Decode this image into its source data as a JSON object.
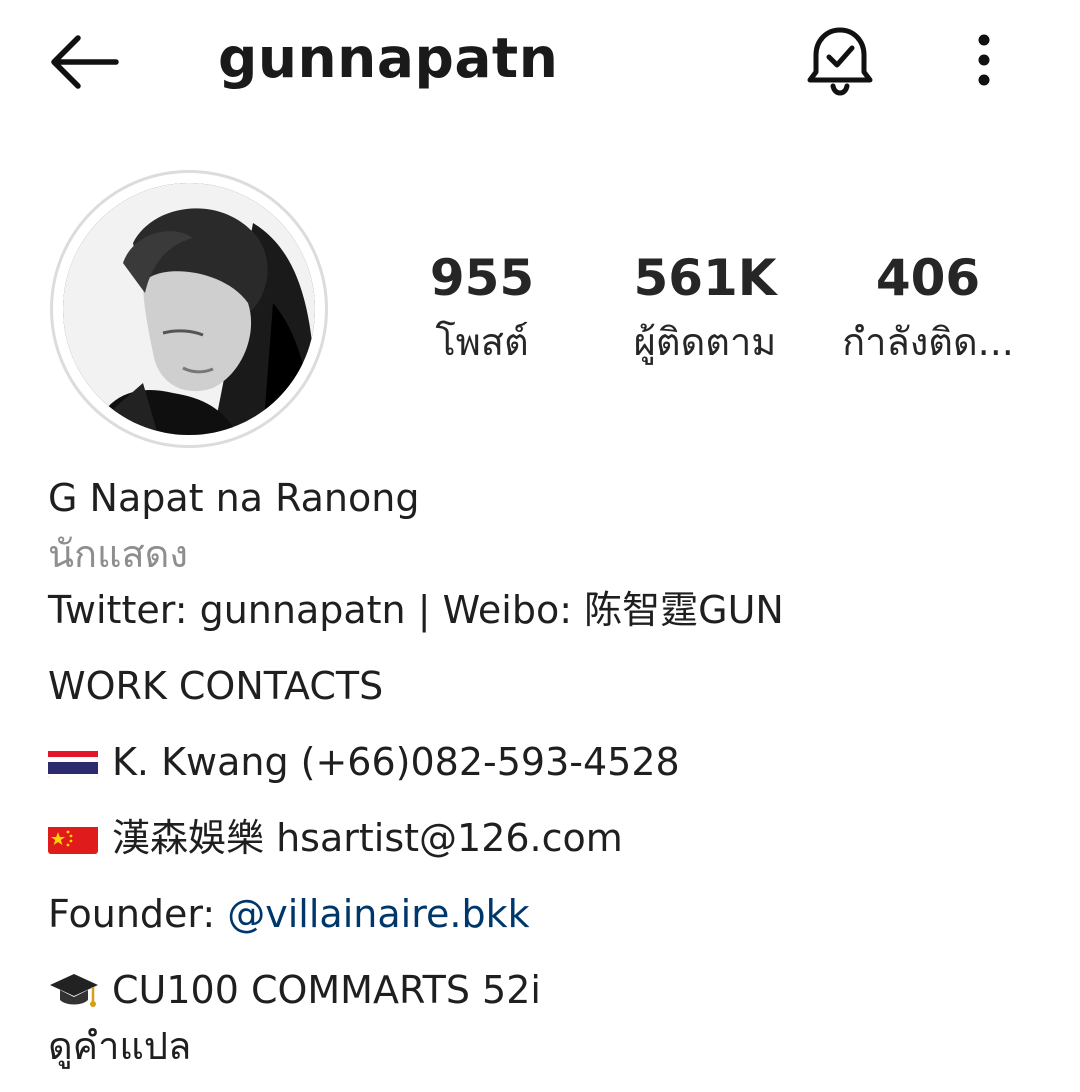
{
  "header": {
    "username": "gunnapatn",
    "back_icon": "arrow-left-icon",
    "bell_icon": "bell-check-icon",
    "more_icon": "more-vertical-icon"
  },
  "profile": {
    "avatar_icon": "profile-photo",
    "stats": [
      {
        "value": "955",
        "label": "โพสต์"
      },
      {
        "value": "561K",
        "label": "ผู้ติดตาม"
      },
      {
        "value": "406",
        "label": "กำลังติด..."
      }
    ]
  },
  "bio": {
    "name": "G Napat  na Ranong",
    "category": "นักแสดง",
    "line1": "Twitter: gunnapatn | Weibo: 陈智霆GUN",
    "work_contacts": "WORK CONTACTS",
    "contact_th": "K. Kwang (+66)082-593-4528",
    "contact_cn": "漢森娛樂 hsartist@126.com",
    "founder_label": "Founder: ",
    "founder_link": "@villainaire.bkk",
    "education": "CU100 COMMARTS 52i",
    "translate": "ดูคำแปล"
  },
  "icons": {
    "flag_th": "thailand-flag-icon",
    "flag_cn": "china-flag-icon",
    "cap": "graduation-cap-icon"
  },
  "colors": {
    "text": "#262626",
    "muted": "#8e8e8e",
    "link": "#00376b"
  }
}
